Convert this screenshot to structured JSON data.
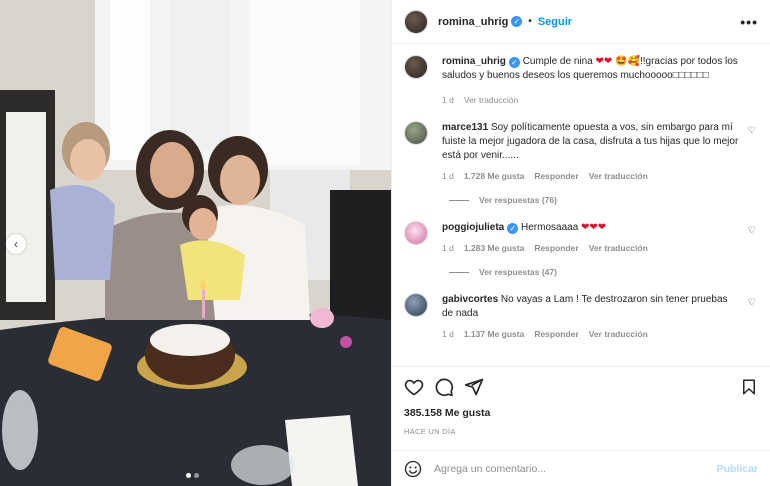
{
  "post": {
    "author": "romina_uhrig",
    "follow_label": "Seguir",
    "caption_text": "Cumple de nina",
    "caption_hearts": "❤❤",
    "caption_emojis": "🤩🥰",
    "caption_rest": "!!gracias por todos los saludos y buenos deseos los queremos muchooooo□□□□□□",
    "caption_time": "1 d",
    "caption_translate": "Ver traducción",
    "likes": "385.158 Me gusta",
    "posted_ago": "HACE UN DÍA",
    "comment_placeholder": "Agrega un comentario...",
    "publish_label": "Publicar",
    "slide_count": 2,
    "active_slide": 1
  },
  "comments": [
    {
      "user": "marce131",
      "text": "Soy políticamente opuesta a vos, sin embargo para mí fuiste la mejor jugadora de la casa, disfruta a tus hijas que lo mejor está por venir......",
      "time": "1 d",
      "likes": "1.728 Me gusta",
      "reply": "Responder",
      "translate": "Ver traducción",
      "view_replies": "Ver respuestas (76)",
      "verified": false
    },
    {
      "user": "poggiojulieta",
      "text": "Hermosaaaa",
      "hearts": "❤❤❤",
      "time": "1 d",
      "likes": "1.283 Me gusta",
      "reply": "Responder",
      "translate": "Ver traducción",
      "view_replies": "Ver respuestas (47)",
      "verified": true
    },
    {
      "user": "gabivcortes",
      "text": "No vayas a Lam ! Te destrozaron sin tener pruebas de nada",
      "time": "1 d",
      "likes": "1.137 Me gusta",
      "reply": "Responder",
      "translate": "Ver traducción",
      "verified": false
    }
  ],
  "icons": {
    "more": "more-options-icon",
    "like": "heart-icon",
    "comment": "comment-icon",
    "share": "share-icon",
    "save": "bookmark-icon",
    "emoji": "emoji-icon",
    "prev": "chevron-left-icon"
  },
  "colors": {
    "accent": "#0095f6",
    "publish_disabled": "#b3dbff",
    "verified": "#3897f0",
    "muted": "#8e8e8e"
  }
}
